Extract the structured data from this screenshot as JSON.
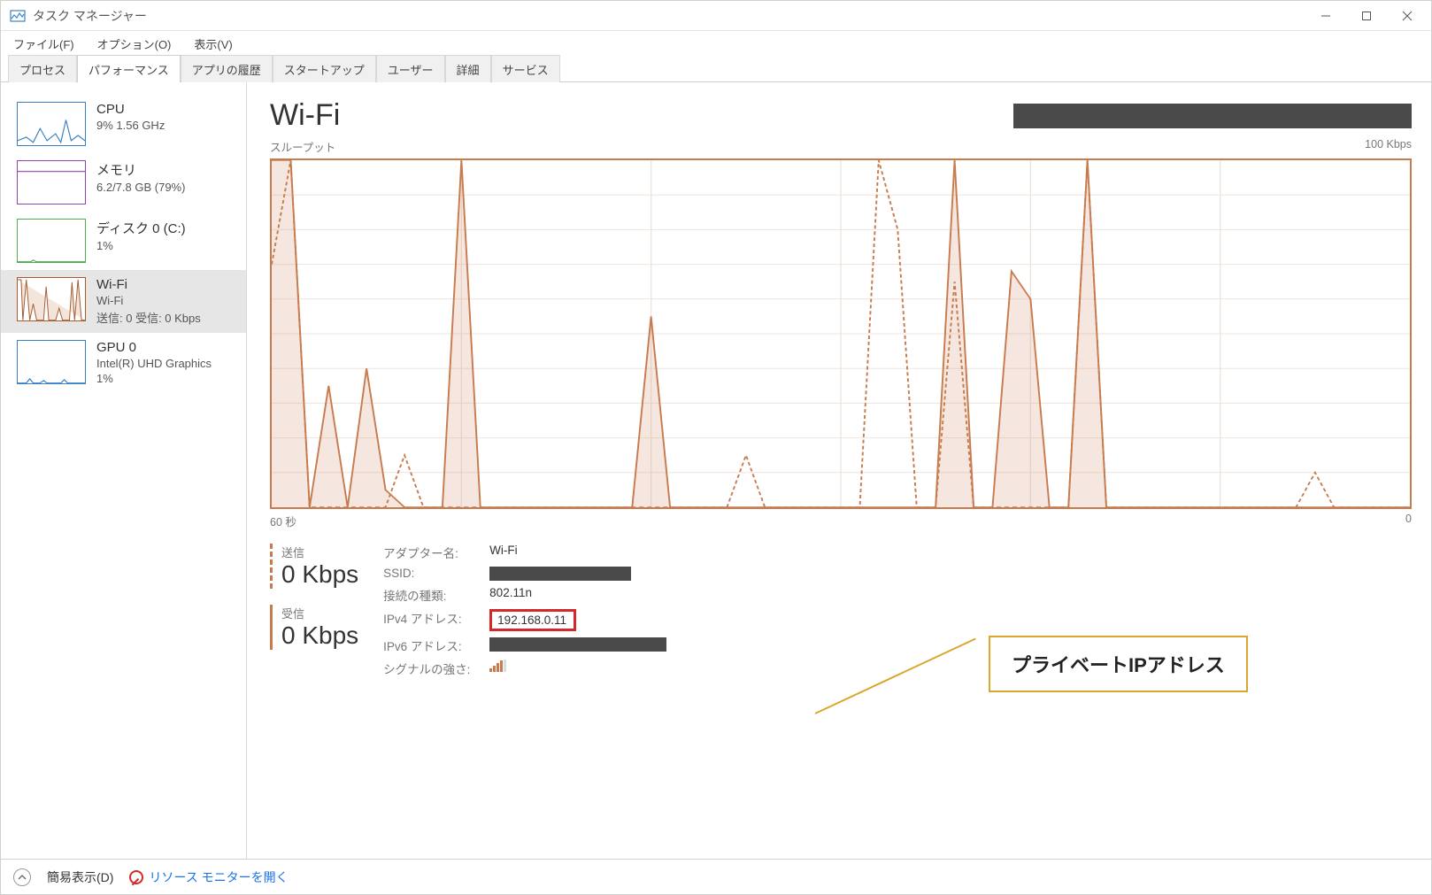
{
  "window_title": "タスク マネージャー",
  "menubar": {
    "file": "ファイル(F)",
    "options": "オプション(O)",
    "view": "表示(V)"
  },
  "tabs": {
    "processes": "プロセス",
    "performance": "パフォーマンス",
    "app_history": "アプリの履歴",
    "startup": "スタートアップ",
    "users": "ユーザー",
    "details": "詳細",
    "services": "サービス"
  },
  "sidebar": [
    {
      "name": "CPU",
      "sub": "9%  1.56 GHz",
      "color": "#3b82c4"
    },
    {
      "name": "メモリ",
      "sub": "6.2/7.8 GB (79%)",
      "color": "#8e44ad"
    },
    {
      "name": "ディスク 0 (C:)",
      "sub": "1%",
      "color": "#4caf50"
    },
    {
      "name": "Wi-Fi",
      "sub": "Wi-Fi",
      "sub2": "送信: 0 受信: 0 Kbps",
      "color": "#a65a2e",
      "selected": true
    },
    {
      "name": "GPU 0",
      "sub": "Intel(R) UHD Graphics",
      "sub2": "1%",
      "color": "#3b82c4"
    }
  ],
  "main": {
    "title": "Wi-Fi",
    "chart_label_left": "スループット",
    "chart_label_right": "100 Kbps",
    "chart_axis_left": "60 秒",
    "chart_axis_right": "0",
    "send_label": "送信",
    "send_value": "0 Kbps",
    "recv_label": "受信",
    "recv_value": "0 Kbps"
  },
  "details": {
    "adapter_label": "アダプター名:",
    "adapter_value": "Wi-Fi",
    "ssid_label": "SSID:",
    "conn_label": "接続の種類:",
    "conn_value": "802.11n",
    "ipv4_label": "IPv4 アドレス:",
    "ipv4_value": "192.168.0.11",
    "ipv6_label": "IPv6 アドレス:",
    "signal_label": "シグナルの強さ:"
  },
  "callout": "プライベートIPアドレス",
  "bottombar": {
    "simple": "簡易表示(D)",
    "resmon": "リソース モニターを開く"
  },
  "chart_data": {
    "type": "line",
    "title": "スループット",
    "xlabel": "秒",
    "ylabel": "Kbps",
    "xlim": [
      60,
      0
    ],
    "ylim": [
      0,
      100
    ],
    "x": [
      60,
      59,
      58,
      57,
      56,
      55,
      54,
      53,
      52,
      51,
      50,
      49,
      48,
      47,
      46,
      45,
      44,
      43,
      42,
      41,
      40,
      39,
      38,
      37,
      36,
      35,
      34,
      33,
      32,
      31,
      30,
      29,
      28,
      27,
      26,
      25,
      24,
      23,
      22,
      21,
      20,
      19,
      18,
      17,
      16,
      15,
      14,
      13,
      12,
      11,
      10,
      9,
      8,
      7,
      6,
      5,
      4,
      3,
      2,
      1,
      0
    ],
    "series": [
      {
        "name": "受信",
        "style": "solid",
        "color": "#c77b4f",
        "values": [
          100,
          100,
          0,
          35,
          0,
          40,
          5,
          0,
          0,
          0,
          100,
          0,
          0,
          0,
          0,
          0,
          0,
          0,
          0,
          0,
          55,
          0,
          0,
          0,
          0,
          0,
          0,
          0,
          0,
          0,
          0,
          0,
          0,
          0,
          0,
          0,
          100,
          0,
          0,
          68,
          60,
          0,
          0,
          100,
          0,
          0,
          0,
          0,
          0,
          0,
          0,
          0,
          0,
          0,
          0,
          0,
          0,
          0,
          0,
          0,
          0
        ]
      },
      {
        "name": "送信",
        "style": "dashed",
        "color": "#c77b4f",
        "values": [
          70,
          100,
          0,
          0,
          0,
          0,
          0,
          15,
          0,
          0,
          0,
          0,
          0,
          0,
          0,
          0,
          0,
          0,
          0,
          0,
          0,
          0,
          0,
          0,
          0,
          15,
          0,
          0,
          0,
          0,
          0,
          0,
          100,
          80,
          0,
          0,
          65,
          0,
          0,
          0,
          0,
          0,
          0,
          100,
          0,
          0,
          0,
          0,
          0,
          0,
          0,
          0,
          0,
          0,
          0,
          10,
          0,
          0,
          0,
          0,
          0
        ]
      }
    ]
  }
}
